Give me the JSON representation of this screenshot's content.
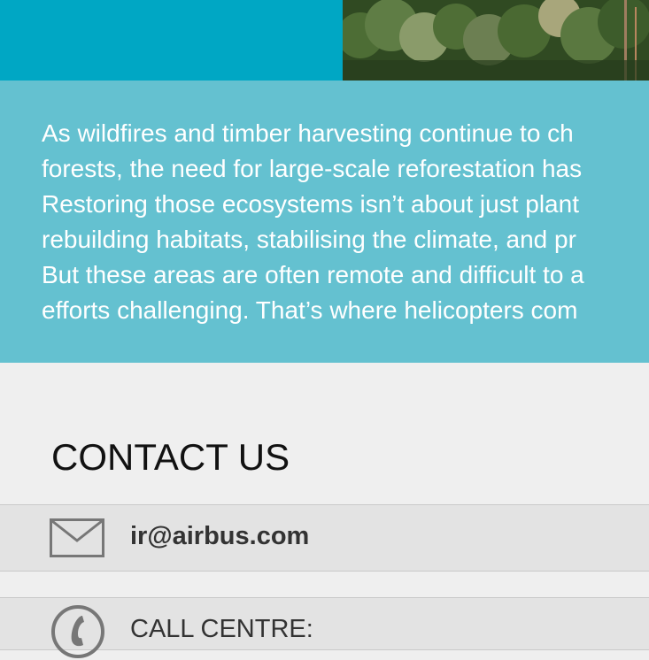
{
  "article": {
    "lines": [
      "As wildfires and timber harvesting continue to ch",
      "forests, the need for large-scale reforestation has",
      "Restoring those ecosystems isn’t about just plant",
      "rebuilding habitats, stabilising the climate, and pr",
      "But these areas are often remote and difficult to a",
      "efforts challenging. That’s where helicopters com"
    ]
  },
  "contact": {
    "title": "CONTACT US",
    "email": "ir@airbus.com",
    "phone_label": "CALL CENTRE:"
  },
  "icons": {
    "email": "envelope-icon",
    "phone": "phone-icon"
  },
  "colors": {
    "header_band": "#00a7c4",
    "article_background": "#64c1d0",
    "page_background": "#efefef",
    "contact_row_background": "#e3e3e3"
  }
}
